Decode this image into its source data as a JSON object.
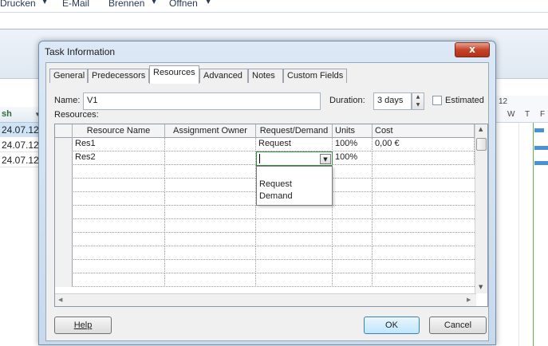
{
  "app": {
    "menu": [
      {
        "label": "Drucken"
      },
      {
        "label": "E-Mail"
      },
      {
        "label": "Brennen"
      },
      {
        "label": "Öffnen"
      }
    ],
    "sheet": {
      "column_header": "sh",
      "rows": [
        "24.07.12",
        "24.07.12",
        "24.07.12"
      ]
    },
    "gantt": {
      "week_label": "12",
      "day_labels": [
        "W",
        "T",
        "F"
      ]
    }
  },
  "dialog": {
    "title": "Task Information",
    "close_label": "x",
    "tabs": [
      {
        "label": "General",
        "active": false
      },
      {
        "label": "Predecessors",
        "active": false
      },
      {
        "label": "Resources",
        "active": true
      },
      {
        "label": "Advanced",
        "active": false
      },
      {
        "label": "Notes",
        "active": false
      },
      {
        "label": "Custom Fields",
        "active": false
      }
    ],
    "name_label": "Name:",
    "name_value": "V1",
    "duration_label": "Duration:",
    "duration_value": "3 days",
    "estimated_label": "Estimated",
    "estimated_checked": false,
    "resources_label": "Resources:",
    "grid": {
      "columns": [
        "Resource Name",
        "Assignment Owner",
        "Request/Demand",
        "Units",
        "Cost"
      ],
      "rows": [
        {
          "name": "Res1",
          "owner": "",
          "request": "Request",
          "units": "100%",
          "cost": "0,00 €"
        },
        {
          "name": "Res2",
          "owner": "",
          "request": "",
          "units": "100%",
          "cost": ""
        }
      ],
      "dropdown_options": [
        "Request",
        "Demand"
      ]
    },
    "help_label": "Help",
    "ok_label": "OK",
    "cancel_label": "Cancel"
  }
}
